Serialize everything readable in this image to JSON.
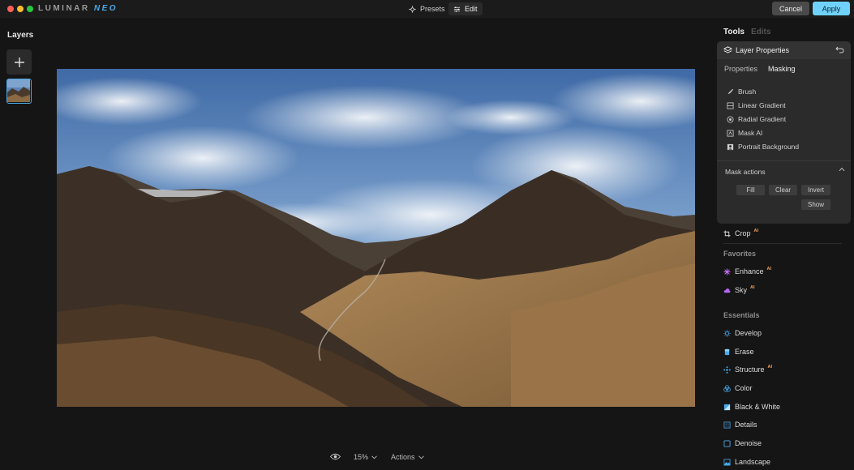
{
  "app": {
    "brand_main": "LUMINAR",
    "brand_accent": "NEO"
  },
  "colors": {
    "accent": "#4aa8e8",
    "apply": "#6fd2fb",
    "ai_badge": "#f0a060",
    "tool_icon": "#4aa8e8"
  },
  "topbar": {
    "presets_label": "Presets",
    "edit_label": "Edit",
    "cancel_label": "Cancel",
    "apply_label": "Apply"
  },
  "layers": {
    "title": "Layers"
  },
  "bottombar": {
    "zoom": "15%",
    "actions_label": "Actions"
  },
  "right": {
    "tab_tools": "Tools",
    "tab_edits": "Edits",
    "layer_properties": {
      "title": "Layer Properties",
      "tab_properties": "Properties",
      "tab_masking": "Masking",
      "mask_tools": [
        {
          "label": "Brush",
          "icon": "brush-icon"
        },
        {
          "label": "Linear Gradient",
          "icon": "linear-gradient-icon"
        },
        {
          "label": "Radial Gradient",
          "icon": "radial-gradient-icon"
        },
        {
          "label": "Mask AI",
          "icon": "mask-ai-icon"
        },
        {
          "label": "Portrait Background",
          "icon": "portrait-icon"
        }
      ],
      "mask_actions_label": "Mask actions",
      "actions": {
        "fill": "Fill",
        "clear": "Clear",
        "invert": "Invert",
        "show": "Show"
      }
    },
    "crop": {
      "label": "Crop",
      "ai": "AI"
    },
    "favorites": {
      "title": "Favorites",
      "items": [
        {
          "label": "Enhance",
          "ai": "AI"
        },
        {
          "label": "Sky",
          "ai": "AI"
        }
      ]
    },
    "essentials": {
      "title": "Essentials",
      "items": [
        {
          "label": "Develop"
        },
        {
          "label": "Erase"
        },
        {
          "label": "Structure",
          "ai": "AI"
        },
        {
          "label": "Color"
        },
        {
          "label": "Black & White"
        },
        {
          "label": "Details"
        },
        {
          "label": "Denoise"
        },
        {
          "label": "Landscape"
        }
      ]
    }
  }
}
